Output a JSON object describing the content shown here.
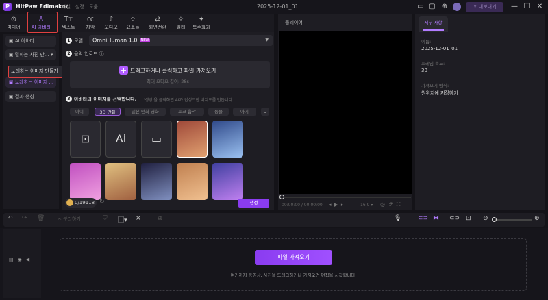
{
  "app": {
    "title": "HitPaw Edimakor",
    "menu": [
      "파일",
      "설정",
      "도움"
    ],
    "project_title": "2025-12-01_01",
    "export_label": "내보내기"
  },
  "tabs": [
    {
      "label": "미디어",
      "icon": "media-icon"
    },
    {
      "label": "AI 아바타",
      "icon": "avatar-icon",
      "active": true
    },
    {
      "label": "텍스트",
      "icon": "text-icon"
    },
    {
      "label": "자막",
      "icon": "caption-icon"
    },
    {
      "label": "오디오",
      "icon": "audio-icon"
    },
    {
      "label": "요소들",
      "icon": "elements-icon"
    },
    {
      "label": "화면전환",
      "icon": "transition-icon"
    },
    {
      "label": "필터",
      "icon": "filter-icon"
    },
    {
      "label": "특수효과",
      "icon": "effects-icon"
    }
  ],
  "sidebar": {
    "items": [
      {
        "label": "AI 아바타"
      },
      {
        "label": "말하는 사진 만..."
      },
      {
        "label": "노래하는 이미지 ..."
      },
      {
        "label": "결과 생성"
      }
    ],
    "tooltip": "노래하는 이미지 만들기"
  },
  "panel": {
    "step1": {
      "label": "모델",
      "value": "OmniHuman 1.0",
      "badge": "NEW"
    },
    "step2": {
      "label": "음악 업로드",
      "upload_text": "드래그하거나 클릭하고 파일 가져오기",
      "upload_hint": "최대 오디오 길이: 28s"
    },
    "step3": {
      "label": "아바타의 이미지를 선택합니다.",
      "hint": "'생성'을 클릭하면 AI가 립싱크한 비디오를 만듭니다.",
      "categories": [
        "마이",
        "3D 만화",
        "일본 만화 영화",
        "포크 음악",
        "동물",
        "아기"
      ],
      "active_category": "3D 만화"
    },
    "credits": "0/19118",
    "generate_label": "생성"
  },
  "player": {
    "title": "플레이어",
    "time": "00:00:00 / 00:00:00",
    "ratio": "16:9"
  },
  "details": {
    "tab": "세부 사항",
    "fields": [
      {
        "label": "이름:",
        "value": "2025-12-01_01"
      },
      {
        "label": "프레임 속도:",
        "value": "30"
      },
      {
        "label": "가져오기 방식:",
        "value": "원위치에 저장하기"
      }
    ]
  },
  "timeline": {
    "split_label": "분리하기",
    "import_label": "파일 가져오기",
    "hint": "여기까지 동영상, 사진을 드래그하거나 가져오면 편집을 시작합니다."
  },
  "colors": {
    "accent": "#a050ff",
    "highlight": "#e04040"
  }
}
